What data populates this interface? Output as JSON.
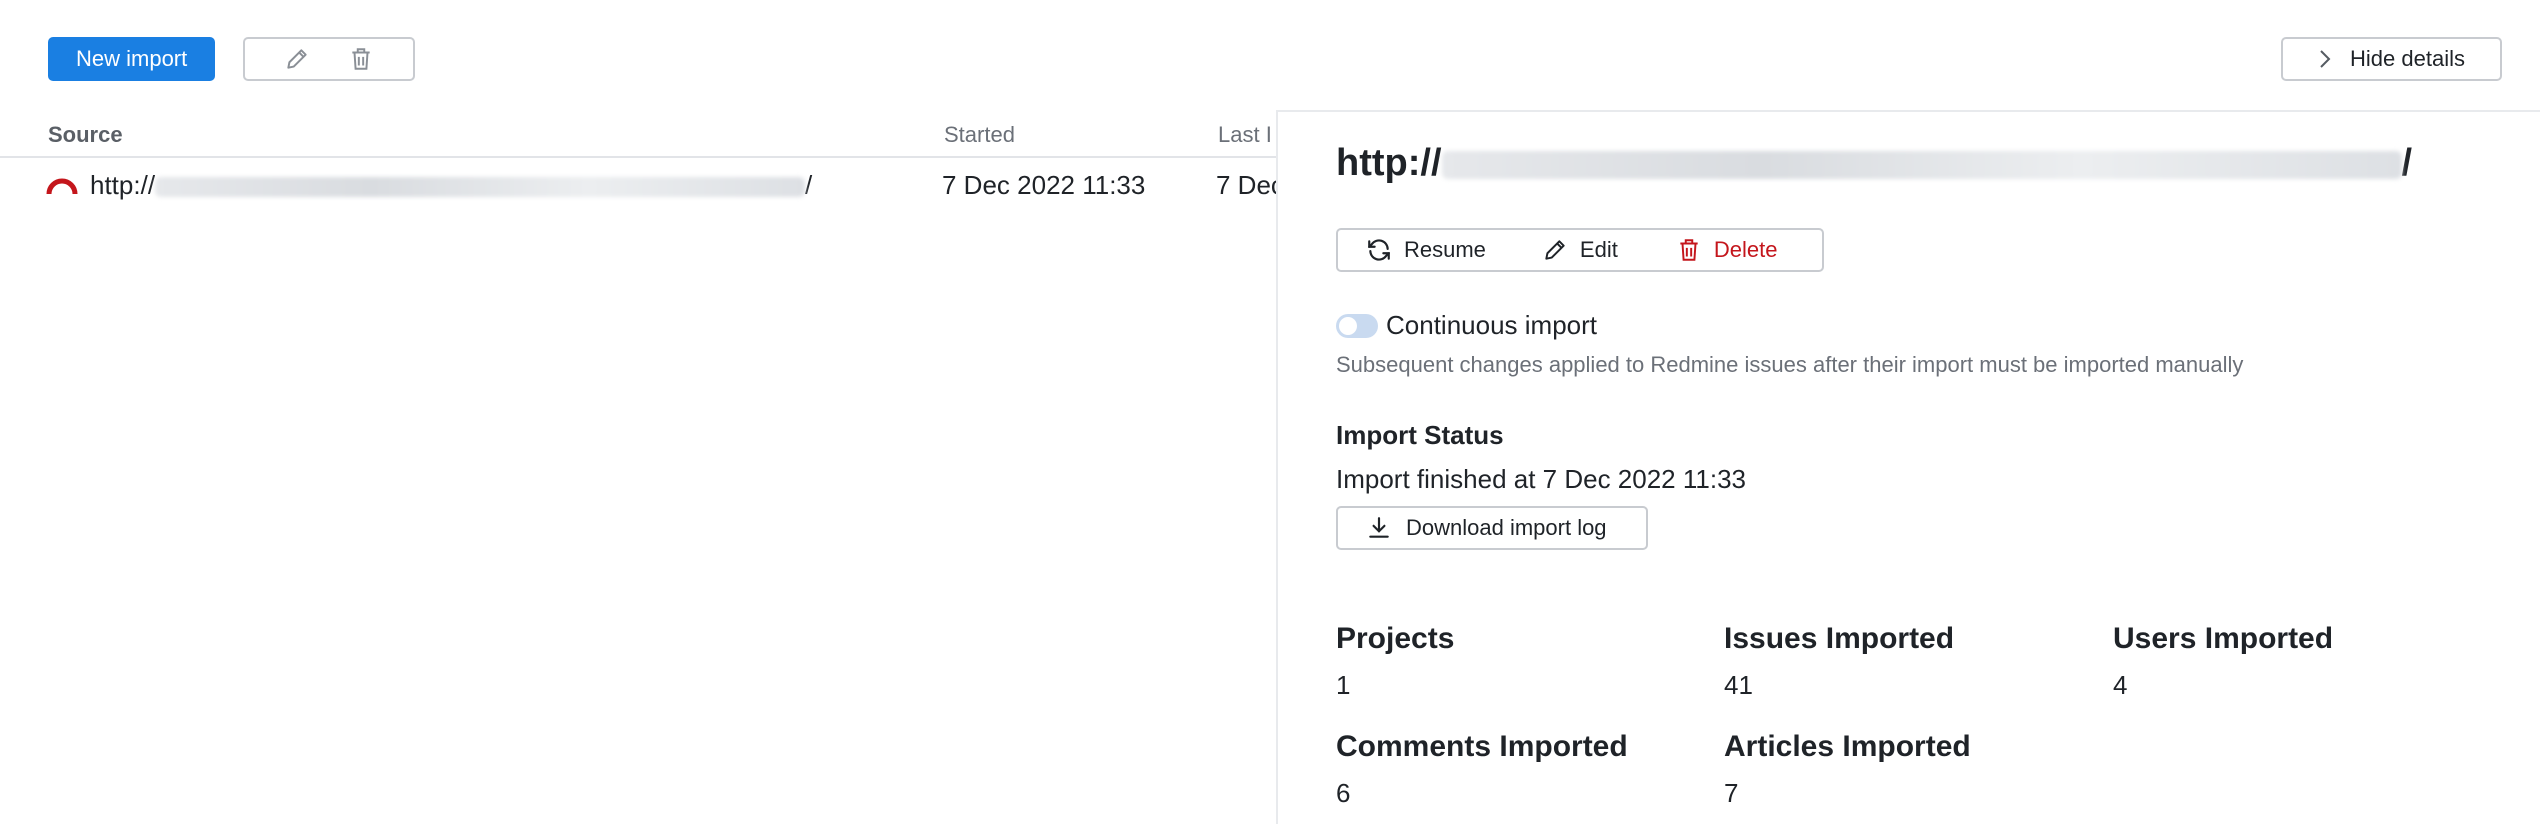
{
  "toolbar": {
    "new_import_label": "New import",
    "edit_icon": "pencil-icon",
    "delete_icon": "trash-icon"
  },
  "table": {
    "headers": {
      "source": "Source",
      "started": "Started",
      "last": "Last I"
    },
    "rows": [
      {
        "source_prefix": "http://",
        "source_suffix": "/",
        "started": "7 Dec 2022 11:33",
        "last": "7 Dec"
      }
    ]
  },
  "hide_details": {
    "label": "Hide details",
    "icon": "chevron-right-icon"
  },
  "details": {
    "title_prefix": "http://",
    "title_suffix": "/",
    "actions": {
      "resume": "Resume",
      "edit": "Edit",
      "delete": "Delete"
    },
    "continuous_import": {
      "label": "Continuous import",
      "enabled": false,
      "hint": "Subsequent changes applied to Redmine issues after their import must be imported manually"
    },
    "import_status": {
      "title": "Import Status",
      "text": "Import finished at 7 Dec 2022 11:33",
      "download_label": "Download import log"
    },
    "stats": {
      "projects_label": "Projects",
      "projects_value": "1",
      "issues_label": "Issues Imported",
      "issues_value": "41",
      "users_label": "Users Imported",
      "users_value": "4",
      "comments_label": "Comments Imported",
      "comments_value": "6",
      "articles_label": "Articles Imported",
      "articles_value": "7"
    }
  },
  "colors": {
    "primary": "#1a7fe2",
    "danger": "#c4161c",
    "redmine_logo": "#c4161c"
  }
}
